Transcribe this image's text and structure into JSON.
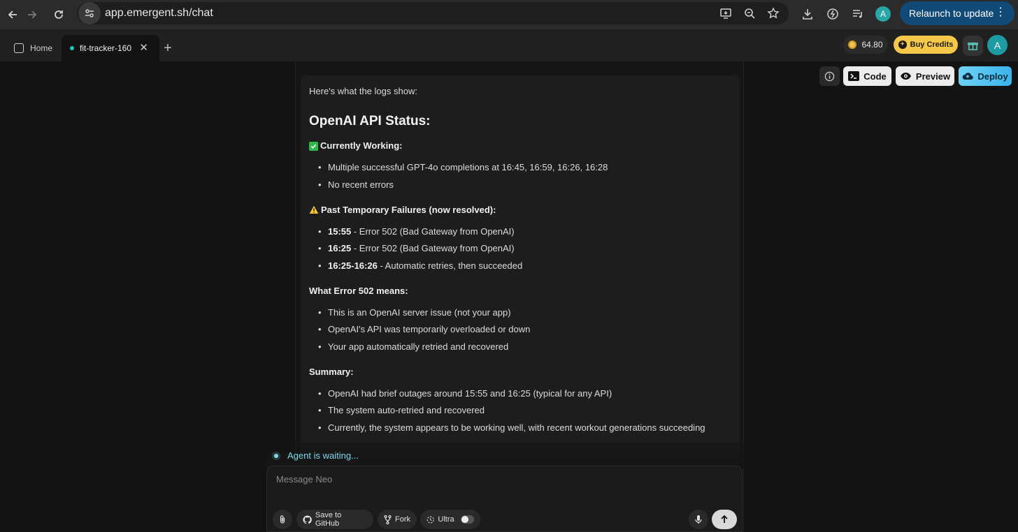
{
  "browser": {
    "url": "app.emergent.sh/chat",
    "relaunch_label": "Relaunch to update",
    "profile_initial": "A"
  },
  "tabs": [
    {
      "label": "Home",
      "active": false
    },
    {
      "label": "fit-tracker-160",
      "active": true
    }
  ],
  "header": {
    "credits": "64.80",
    "buy_credits_label": "Buy Credits",
    "user_initial": "A"
  },
  "actions": {
    "code_label": "Code",
    "preview_label": "Preview",
    "deploy_label": "Deploy"
  },
  "message": {
    "intro": "Here's what the logs show:",
    "title": "OpenAI API Status:",
    "sections": [
      {
        "icon": "check-icon",
        "heading": "Currently Working:",
        "items": [
          {
            "bold": "",
            "text": "Multiple successful GPT-4o completions at 16:45, 16:59, 16:26, 16:28"
          },
          {
            "bold": "",
            "text": "No recent errors"
          }
        ]
      },
      {
        "icon": "warning-icon",
        "heading": "Past Temporary Failures (now resolved):",
        "items": [
          {
            "bold": "15:55",
            "text": " - Error 502 (Bad Gateway from OpenAI)"
          },
          {
            "bold": "16:25",
            "text": " - Error 502 (Bad Gateway from OpenAI)"
          },
          {
            "bold": "16:25-16:26",
            "text": " - Automatic retries, then succeeded"
          }
        ]
      },
      {
        "icon": "",
        "heading": "What Error 502 means:",
        "items": [
          {
            "bold": "",
            "text": "This is an OpenAI server issue (not your app)"
          },
          {
            "bold": "",
            "text": "OpenAI's API was temporarily overloaded or down"
          },
          {
            "bold": "",
            "text": "Your app automatically retried and recovered"
          }
        ]
      },
      {
        "icon": "",
        "heading": "Summary:",
        "items": [
          {
            "bold": "",
            "text": "OpenAI had brief outages around 15:55 and 16:25 (typical for any API)"
          },
          {
            "bold": "",
            "text": "The system auto-retried and recovered"
          },
          {
            "bold": "",
            "text": "Currently, the system appears to be working well, with recent workout generations succeeding"
          }
        ]
      }
    ]
  },
  "status": {
    "text": "Agent is waiting..."
  },
  "composer": {
    "placeholder": "Message Neo",
    "github_label": "Save to GitHub",
    "fork_label": "Fork",
    "ultra_label": "Ultra",
    "ultra_enabled": false
  }
}
